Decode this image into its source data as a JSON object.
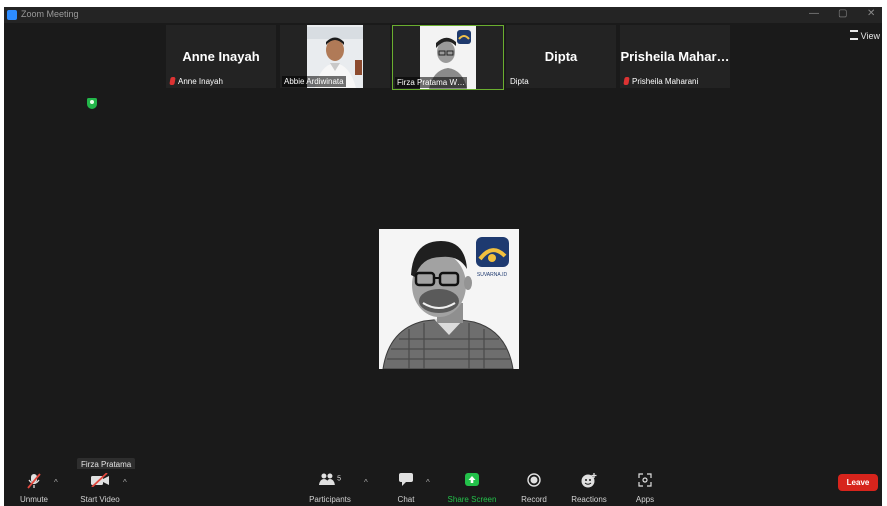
{
  "window": {
    "title": "Zoom Meeting",
    "controls": [
      "—",
      "▢",
      "✕"
    ]
  },
  "view_button": {
    "label": "View"
  },
  "participants_strip": [
    {
      "display_name": "Anne Inayah",
      "label": "Anne Inayah",
      "muted": true
    },
    {
      "display_name": "",
      "label": "Abbie Ardiwinata",
      "muted": false
    },
    {
      "display_name": "",
      "label": "Firza Pratama W…",
      "muted": false,
      "active": true
    },
    {
      "display_name": "Dipta",
      "label": "Dipta",
      "muted": false
    },
    {
      "display_name": "Prisheila Mahar…",
      "label": "Prisheila Maharani",
      "muted": true
    }
  ],
  "main_video": {
    "logo_text": "SUVARNA.ID"
  },
  "tooltip": {
    "text": "Firza Pratama"
  },
  "toolbar": {
    "unmute_label": "Unmute",
    "start_video_label": "Start Video",
    "participants_label": "Participants",
    "participants_count": "5",
    "chat_label": "Chat",
    "share_screen_label": "Share Screen",
    "record_label": "Record",
    "reactions_label": "Reactions",
    "apps_label": "Apps",
    "leave_label": "Leave"
  },
  "colors": {
    "share_green": "#23c14a",
    "leave_red": "#d7241c",
    "active_border": "#6aae2f",
    "background": "#1a1a1a"
  }
}
